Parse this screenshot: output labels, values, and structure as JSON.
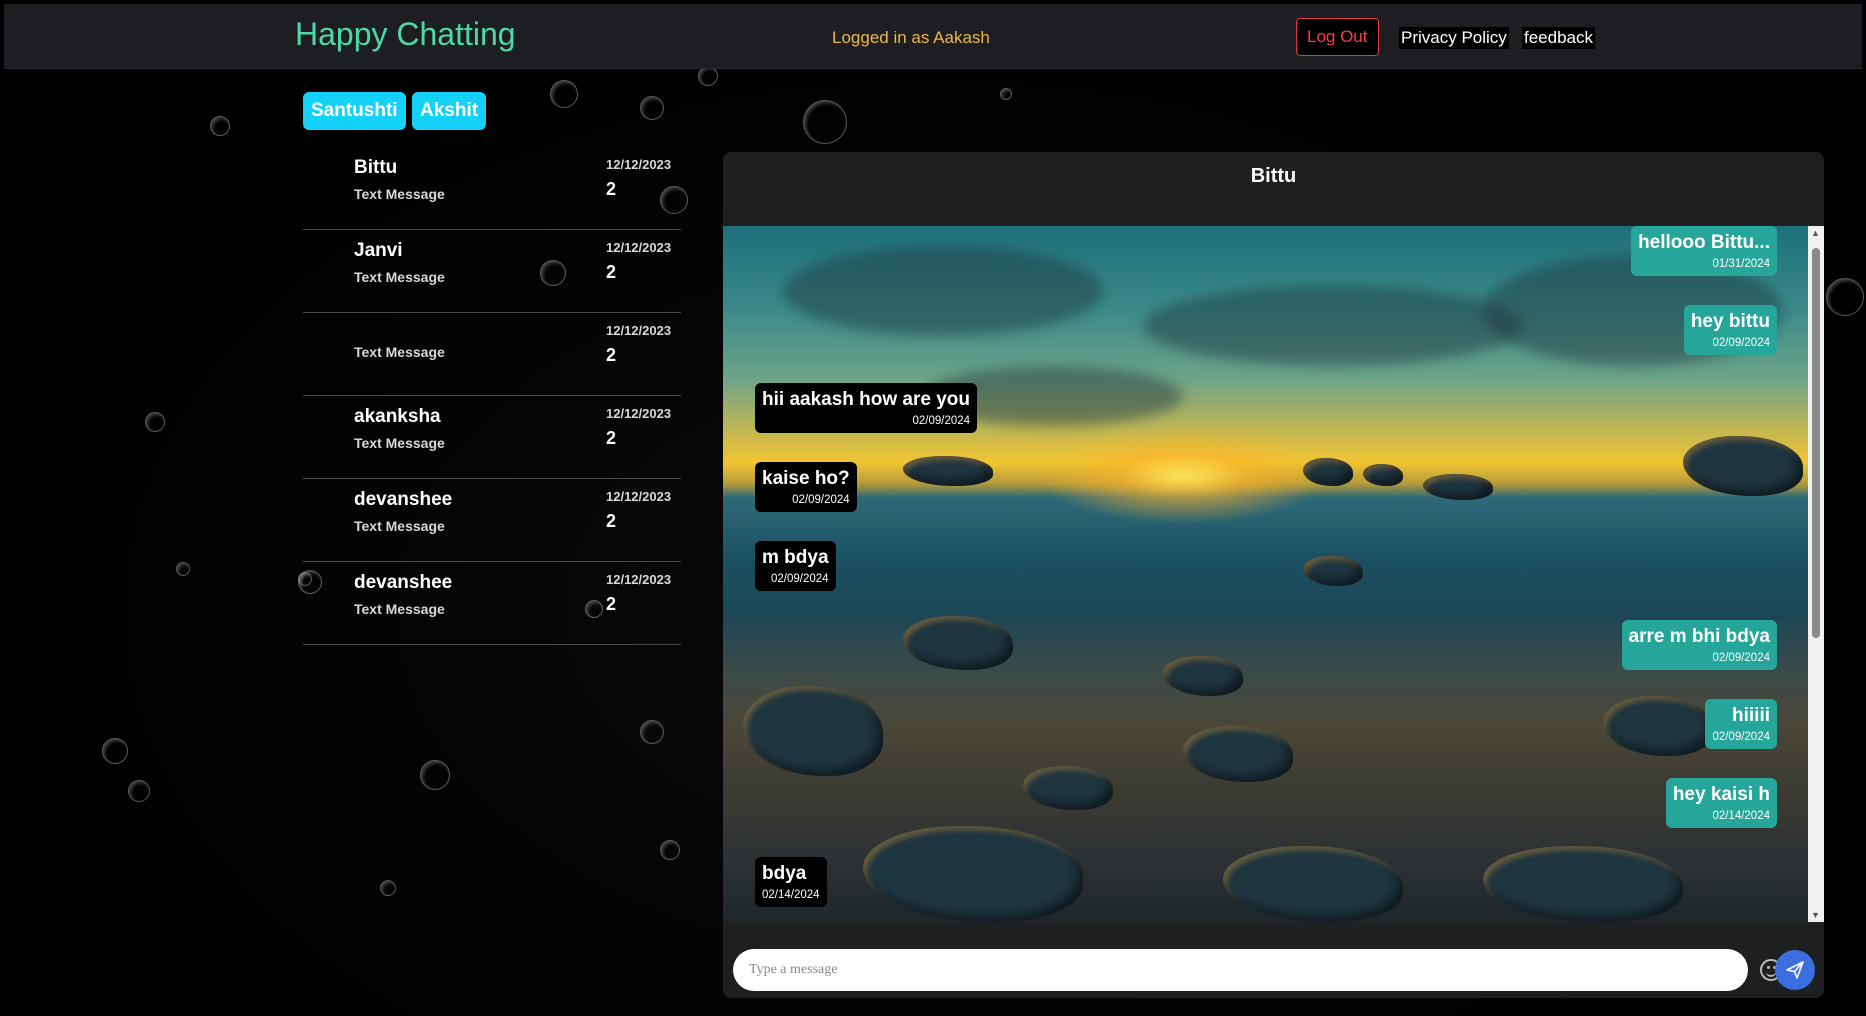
{
  "header": {
    "brand": "Happy Chatting",
    "logged_in": "Logged in as Aakash",
    "logout": "Log Out",
    "privacy": "Privacy Policy",
    "feedback": "feedback"
  },
  "groups": [
    "Santushti",
    "Akshit"
  ],
  "contacts": [
    {
      "name": "Bittu",
      "preview": "Text Message",
      "date": "12/12/2023",
      "count": "2"
    },
    {
      "name": "Janvi",
      "preview": "Text Message",
      "date": "12/12/2023",
      "count": "2"
    },
    {
      "name": "",
      "preview": "Text Message",
      "date": "12/12/2023",
      "count": "2"
    },
    {
      "name": "akanksha",
      "preview": "Text Message",
      "date": "12/12/2023",
      "count": "2"
    },
    {
      "name": "devanshee",
      "preview": "Text Message",
      "date": "12/12/2023",
      "count": "2"
    },
    {
      "name": "devanshee",
      "preview": "Text Message",
      "date": "12/12/2023",
      "count": "2"
    }
  ],
  "chat": {
    "title": "Bittu",
    "messages": [
      {
        "text": "hellooo Bittu...",
        "time": "01/31/2024",
        "direction": "sent"
      },
      {
        "text": "hey bittu",
        "time": "02/09/2024",
        "direction": "sent"
      },
      {
        "text": "hii aakash how are you",
        "time": "02/09/2024",
        "direction": "received"
      },
      {
        "text": "kaise ho?",
        "time": "02/09/2024",
        "direction": "received"
      },
      {
        "text": "m bdya",
        "time": "02/09/2024",
        "direction": "received"
      },
      {
        "text": "arre m bhi bdya",
        "time": "02/09/2024",
        "direction": "sent"
      },
      {
        "text": "hiiiii",
        "time": "02/09/2024",
        "direction": "sent"
      },
      {
        "text": "hey kaisi h",
        "time": "02/14/2024",
        "direction": "sent"
      },
      {
        "text": "bdya",
        "time": "02/14/2024",
        "direction": "received"
      }
    ],
    "input_placeholder": "Type a message"
  },
  "icons": {
    "emoji": "smiley-icon",
    "send": "send-icon"
  },
  "colors": {
    "brand": "#4dd9a6",
    "logged_in": "#f0b64a",
    "logout": "#ff3b3b",
    "group_pill": "#14d2f7",
    "sent_bubble": "#26a69a",
    "received_bubble": "#000000",
    "send_button": "#3b6fe0"
  }
}
